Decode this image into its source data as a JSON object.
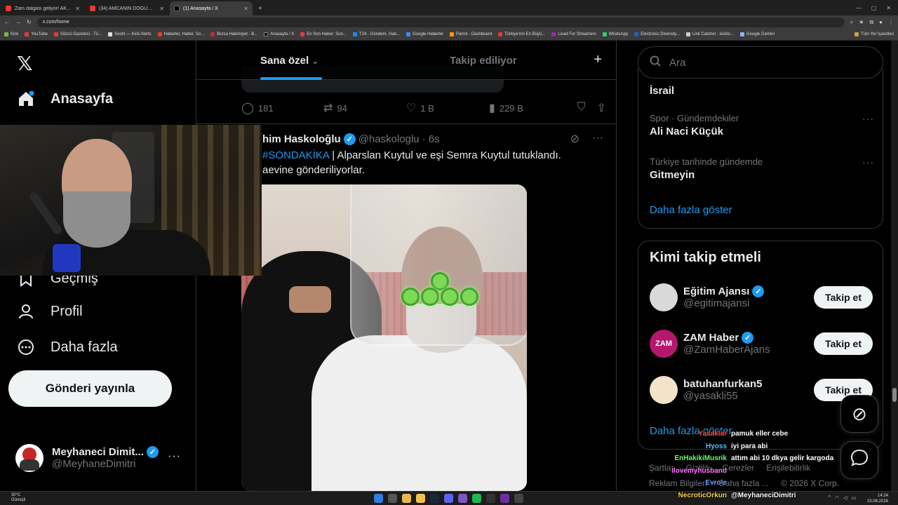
{
  "browser": {
    "tabs": [
      {
        "title": "Zam dalgası geliyor! AKP, 500 ...",
        "active": false
      },
      {
        "title": "(34) AMCANIN DOĞUM GÜNÜ",
        "active": false
      },
      {
        "title": "(1) Anasayfa / X",
        "active": true
      }
    ],
    "new_tab": "+",
    "url": "x.com/home",
    "bookmarks": [
      "Kick",
      "YouTube",
      "Sözcü Gazetesi - Tü...",
      "SooN — Kick Alerts",
      "Haberler, Haber, So...",
      "Bursa Hakimiyet - B...",
      "Anasayfa / X",
      "En Son Haber: Son...",
      "T24 - Gündem, Hab...",
      "Google Haberler",
      "Parrot - Dashboard",
      "Türkiye'nin En Büyü...",
      "Livad For Streamers",
      "WhatsApp",
      "Electronic Diversity...",
      "Link Catcher - kicklo...",
      "Google Gemini"
    ],
    "bookmarks_all": "Tüm Yer İşaretleri"
  },
  "nav": {
    "logo": "𝕏",
    "home": "Anasayfa",
    "history": "Geçmiş",
    "profile": "Profil",
    "more": "Daha fazla",
    "post_button": "Gönderi yayınla",
    "account_name": "Meyhaneci Dimit...",
    "account_handle": "@MeyhaneDimitri",
    "account_more": "···"
  },
  "feed": {
    "tab_for_you": "Sana özel",
    "tab_following": "Takip ediliyor",
    "plus": "+",
    "prev_actions": {
      "replies": "181",
      "reposts": "94",
      "likes": "1 B",
      "views": "229 B"
    },
    "tweet": {
      "name": "him Haskoloğlu",
      "handle": "@haskologlu",
      "time": "· 6s",
      "hashtag": "#SONDAKİKA",
      "text": " | Alparslan Kuytul ve eşi Semra Kuytul tutuklandı.",
      "text2": "aevine gönderiliyorlar."
    }
  },
  "sidebar": {
    "search_placeholder": "Ara",
    "trends": [
      {
        "category": "",
        "name": "İsrail"
      },
      {
        "category": "Spor · Gündemdekiler",
        "name": "Ali Naci Küçük"
      },
      {
        "category": "Türkiye tarihinde gündemde",
        "name": "Gitmeyin"
      }
    ],
    "trends_more": "Daha fazla göster",
    "who_to_follow_title": "Kimi takip etmeli",
    "who_to_follow": [
      {
        "name": "Eğitim Ajansı",
        "handle": "@egitimajansi",
        "verified": true,
        "button": "Takip et",
        "avatar_color": "#d9d9d9"
      },
      {
        "name": "ZAM Haber",
        "handle": "@ZamHaberAjans",
        "verified": true,
        "button": "Takip et",
        "avatar_color": "#b5176f",
        "avatar_text": "ZAM"
      },
      {
        "name": "batuhanfurkan5",
        "handle": "@yasakli55",
        "verified": false,
        "button": "Takip et",
        "avatar_color": "#f2e3c9"
      }
    ],
    "wtf_more": "Daha fazla göster",
    "footer": [
      "Şartlar",
      "Gizlilik",
      "Çerezler",
      "Erişilebilirlik",
      "Reklam Bilgileri",
      "Daha fazla ...",
      "© 2026 X Corp."
    ]
  },
  "chat": [
    {
      "user": "Yasaklar",
      "color": "#ff4d4d",
      "message": "pamuk eller cebe"
    },
    {
      "user": "Hyoss",
      "color": "#5bc0ff",
      "message": "iyi para abi"
    },
    {
      "user": "EnHakikiMusrik",
      "color": "#66ff66",
      "message": "attım abi 10 dkya gelir kargoda"
    },
    {
      "user": "Ilovemyhusband",
      "color": "#ff77ff",
      "message": ""
    },
    {
      "user": "Evrole",
      "color": "#6fa8ff",
      "message": ""
    },
    {
      "user": "NecroticOrkun",
      "color": "#ffd54a",
      "message": "@MeyhaneciDimitri"
    }
  ],
  "taskbar": {
    "weather_temp": "30°C",
    "weather_desc": "Güneşli",
    "time": "14:24",
    "date": "23.08.2026"
  },
  "colors": {
    "accent": "#1d9bf0",
    "background": "#000000",
    "border": "#2f3336",
    "muted": "#71767b"
  }
}
